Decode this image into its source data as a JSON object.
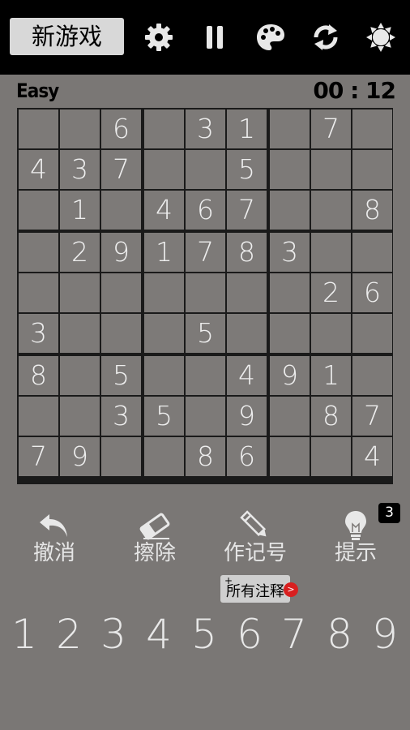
{
  "toolbar": {
    "new_game_label": "新游戏",
    "icons": [
      "settings-icon",
      "pause-icon",
      "palette-icon",
      "refresh-icon",
      "brightness-icon"
    ]
  },
  "status": {
    "difficulty": "Easy",
    "timer": "00 : 12"
  },
  "board": [
    [
      "",
      "",
      "6",
      "",
      "3",
      "1",
      "",
      "7",
      ""
    ],
    [
      "4",
      "3",
      "7",
      "",
      "",
      "5",
      "",
      "",
      ""
    ],
    [
      "",
      "1",
      "",
      "4",
      "6",
      "7",
      "",
      "",
      "8"
    ],
    [
      "",
      "2",
      "9",
      "1",
      "7",
      "8",
      "3",
      "",
      ""
    ],
    [
      "",
      "",
      "",
      "",
      "",
      "",
      "",
      "2",
      "6"
    ],
    [
      "3",
      "",
      "",
      "",
      "5",
      "",
      "",
      "",
      ""
    ],
    [
      "8",
      "",
      "5",
      "",
      "",
      "4",
      "9",
      "1",
      ""
    ],
    [
      "",
      "",
      "3",
      "5",
      "",
      "9",
      "",
      "8",
      "7"
    ],
    [
      "7",
      "9",
      "",
      "",
      "8",
      "6",
      "",
      "",
      "4"
    ]
  ],
  "actions": {
    "undo": "撤消",
    "erase": "擦除",
    "notes": "作记号",
    "hint": "提示",
    "hint_count": "3",
    "all_notes": "所有注释",
    "all_notes_plus": "+",
    "all_notes_toggle": ">"
  },
  "numpad": [
    "1",
    "2",
    "3",
    "4",
    "5",
    "6",
    "7",
    "8",
    "9"
  ]
}
